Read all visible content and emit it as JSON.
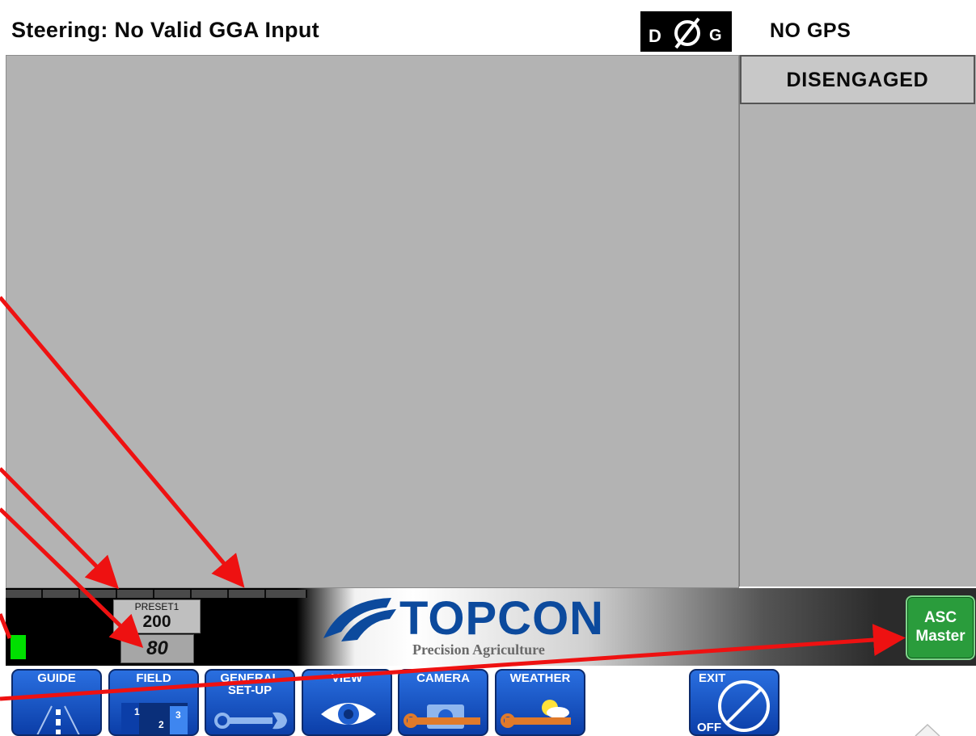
{
  "header": {
    "status_title": "Steering: No Valid GGA Input",
    "dg_left": "D",
    "dg_right": "G",
    "gps_status": "NO GPS"
  },
  "side_panel": {
    "engage_status": "DISENGAGED"
  },
  "rate_control": {
    "preset_label": "PRESET1",
    "preset_value": "200",
    "actual_rate": "80",
    "led_color": "#00e000"
  },
  "logo": {
    "brand": "TOPCON",
    "tagline": "Precision Agriculture"
  },
  "asc_button": {
    "line1": "ASC",
    "line2": "Master",
    "color": "#2a9c3c"
  },
  "nav": {
    "guide": "GUIDE",
    "field": "FIELD",
    "field_zones": [
      "1",
      "2",
      "3"
    ],
    "general_setup": "GENERAL SET-UP",
    "view": "VIEW",
    "camera": "CAMERA",
    "weather": "WEATHER",
    "exit": "EXIT",
    "exit_off": "OFF"
  },
  "colors": {
    "map_background": "#b3b3b3",
    "button_blue": "#1f5fd0",
    "brand_blue": "#0c4a9d",
    "annotation_red": "#ee1111"
  },
  "icons": [
    "no-signal-icon",
    "road-lanes-icon",
    "field-zones-icon",
    "wrench-icon",
    "eye-icon",
    "camera-icon",
    "weather-icon",
    "power-off-icon",
    "up-arrow-icon"
  ]
}
